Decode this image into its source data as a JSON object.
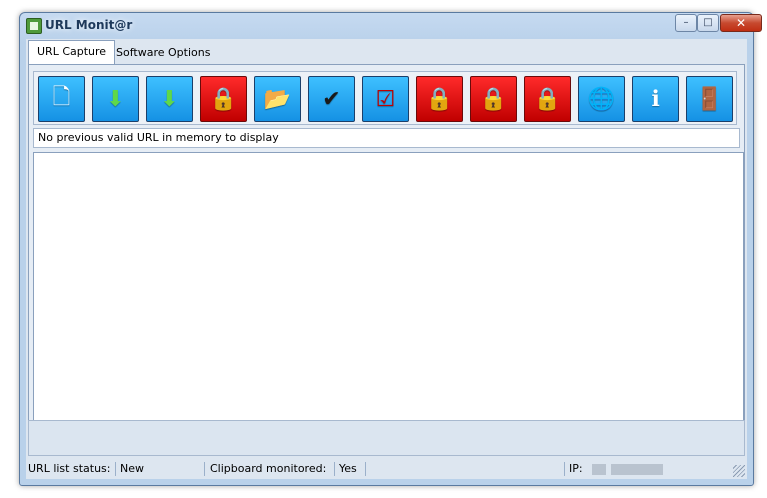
{
  "window": {
    "title": "URL Monit@r",
    "controls": {
      "minimize": "–",
      "maximize": "□",
      "close": "✕"
    }
  },
  "tabs": [
    {
      "label": "URL Capture",
      "active": true
    },
    {
      "label": "Software Options",
      "active": false
    }
  ],
  "toolbar": {
    "buttons": [
      {
        "name": "new-list",
        "icon": "new-document-icon",
        "glyph": "🗋"
      },
      {
        "name": "save",
        "icon": "download-to-drive-icon",
        "glyph": "⬇"
      },
      {
        "name": "save-as",
        "icon": "download-to-drive-alt-icon",
        "glyph": "⬇"
      },
      {
        "name": "lock-1",
        "icon": "padlock-icon",
        "glyph": "🔒"
      },
      {
        "name": "open",
        "icon": "open-folder-icon",
        "glyph": "📂"
      },
      {
        "name": "checklist",
        "icon": "checklist-icon",
        "glyph": "✔"
      },
      {
        "name": "checklist-2",
        "icon": "checklist-red-icon",
        "glyph": "☑"
      },
      {
        "name": "lock-2",
        "icon": "padlock-icon",
        "glyph": "🔒"
      },
      {
        "name": "lock-3",
        "icon": "padlock-icon",
        "glyph": "🔒"
      },
      {
        "name": "lock-4",
        "icon": "padlock-icon",
        "glyph": "🔒"
      },
      {
        "name": "web",
        "icon": "globe-icon",
        "glyph": "🌐"
      },
      {
        "name": "about",
        "icon": "info-icon",
        "glyph": "ℹ"
      },
      {
        "name": "exit",
        "icon": "exit-door-icon",
        "glyph": "🚪"
      }
    ]
  },
  "status_message": "No previous valid URL in memory to display",
  "statusbar": {
    "url_list_label": "URL list status:",
    "url_list_value": "New",
    "clipboard_label": "Clipboard monitored:",
    "clipboard_value": "Yes",
    "ip_label": "IP:"
  }
}
